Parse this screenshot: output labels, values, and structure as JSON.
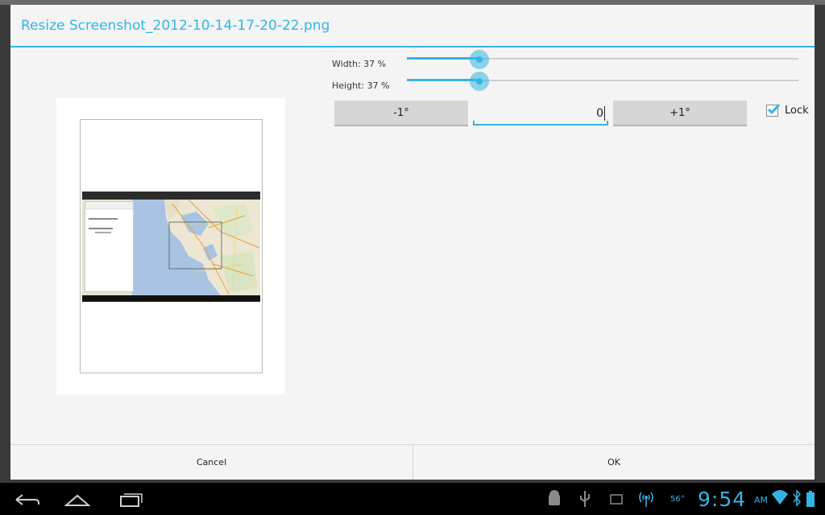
{
  "dialog": {
    "title": "Resize Screenshot_2012-10-14-17-20-22.png"
  },
  "controls": {
    "width_label": "Width: 37 %",
    "height_label": "Height: 37 %",
    "width_value": 0.37,
    "height_value": 0.37,
    "rotate_minus_label": "-1°",
    "rotate_plus_label": "+1°",
    "angle_value": "0",
    "lock_label": "Lock",
    "lock_checked": true
  },
  "buttons": {
    "cancel": "Cancel",
    "ok": "OK"
  },
  "statusbar": {
    "temperature": "56°",
    "time": "9:54",
    "ampm": "AM"
  },
  "colors": {
    "accent": "#33b5e5",
    "dialog_bg": "#f4f4f4",
    "button_bg": "#d6d6d6"
  },
  "icons": {
    "nav": [
      "back-icon",
      "home-icon",
      "recent-apps-icon"
    ],
    "status": [
      "android-debug-icon",
      "usb-icon",
      "screenshot-icon",
      "wireless-tether-icon",
      "wifi-icon",
      "bluetooth-icon",
      "battery-icon"
    ]
  }
}
